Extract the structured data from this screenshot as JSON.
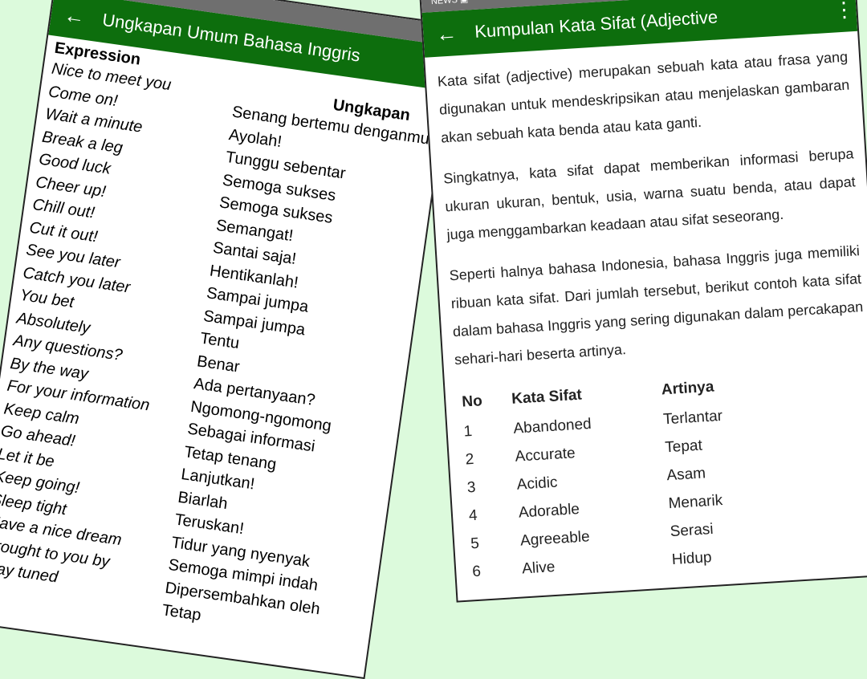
{
  "left_screen": {
    "title": "Ungkapan Umum Bahasa Inggris",
    "headers": {
      "expression": "Expression",
      "ungkapan": "Ungkapan"
    },
    "rows": [
      {
        "en": "Nice to meet you",
        "id": "Senang bertemu denganmu"
      },
      {
        "en": "Come on!",
        "id": "Ayolah!"
      },
      {
        "en": "Wait a minute",
        "id": "Tunggu sebentar"
      },
      {
        "en": "Break a leg",
        "id": "Semoga sukses"
      },
      {
        "en": "Good luck",
        "id": "Semoga sukses"
      },
      {
        "en": "Cheer up!",
        "id": "Semangat!"
      },
      {
        "en": "Chill out!",
        "id": "Santai saja!"
      },
      {
        "en": "Cut it out!",
        "id": "Hentikanlah!"
      },
      {
        "en": "See you later",
        "id": "Sampai jumpa"
      },
      {
        "en": "Catch you later",
        "id": "Sampai jumpa"
      },
      {
        "en": "You bet",
        "id": "Tentu"
      },
      {
        "en": "Absolutely",
        "id": "Benar"
      },
      {
        "en": "Any questions?",
        "id": "Ada pertanyaan?"
      },
      {
        "en": "By the way",
        "id": "Ngomong-ngomong"
      },
      {
        "en": "For your information",
        "id": "Sebagai informasi"
      },
      {
        "en": "Keep calm",
        "id": "Tetap tenang"
      },
      {
        "en": "Go ahead!",
        "id": "Lanjutkan!"
      },
      {
        "en": "Let it be",
        "id": "Biarlah"
      },
      {
        "en": "Keep going!",
        "id": "Teruskan!"
      },
      {
        "en": "Sleep tight",
        "id": "Tidur yang nyenyak"
      },
      {
        "en": "Have a nice dream",
        "id": "Semoga mimpi indah"
      },
      {
        "en": "Brought to you by",
        "id": "Dipersembahkan oleh"
      },
      {
        "en": "Stay tuned",
        "id": "Tetap"
      }
    ]
  },
  "right_screen": {
    "status_icons": "NEWS ▣",
    "title": "Kumpulan Kata Sifat (Adjective",
    "paragraphs": [
      "Kata sifat (adjective) merupakan sebuah kata atau frasa yang digunakan untuk mendeskripsikan atau menjelaskan gambaran akan sebuah kata benda atau kata ganti.",
      "Singkatnya, kata sifat dapat memberikan informasi berupa ukuran ukuran, bentuk, usia, warna suatu benda, atau dapat juga menggambarkan keadaan atau sifat seseorang.",
      "Seperti halnya bahasa Indonesia, bahasa Inggris juga memiliki ribuan kata sifat. Dari jumlah tersebut, berikut contoh kata sifat dalam bahasa Inggris yang sering digunakan dalam percakapan sehari-hari beserta artinya."
    ],
    "table": {
      "headers": [
        "No",
        "Kata Sifat",
        "Artinya"
      ],
      "rows": [
        [
          "1",
          "Abandoned",
          "Terlantar"
        ],
        [
          "2",
          "Accurate",
          "Tepat"
        ],
        [
          "3",
          "Acidic",
          "Asam"
        ],
        [
          "4",
          "Adorable",
          "Menarik"
        ],
        [
          "5",
          "Agreeable",
          "Serasi"
        ],
        [
          "6",
          "Alive",
          "Hidup"
        ]
      ]
    }
  }
}
